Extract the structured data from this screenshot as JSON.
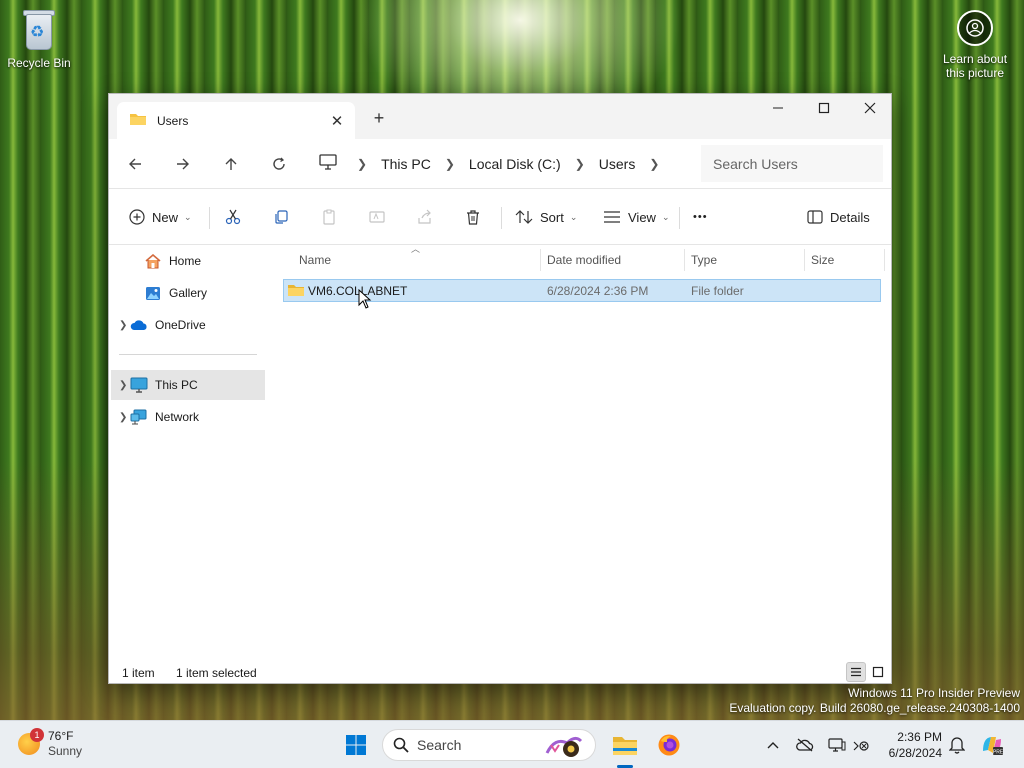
{
  "desktop": {
    "recycle_bin_label": "Recycle Bin",
    "learn_line1": "Learn about",
    "learn_line2": "this picture",
    "watermark_line1": "Windows 11 Pro Insider Preview",
    "watermark_line2": "Evaluation copy. Build 26080.ge_release.240308-1400"
  },
  "window": {
    "tab_title": "Users",
    "tab_close": "✕",
    "new_tab": "+",
    "breadcrumb": [
      "This PC",
      "Local Disk (C:)",
      "Users"
    ],
    "search_placeholder": "Search Users",
    "toolbar": {
      "new_label": "New",
      "sort_label": "Sort",
      "view_label": "View",
      "more_label": "•••",
      "details_label": "Details"
    },
    "nav": {
      "home": "Home",
      "gallery": "Gallery",
      "onedrive": "OneDrive",
      "this_pc": "This PC",
      "network": "Network"
    },
    "columns": {
      "name": "Name",
      "date": "Date modified",
      "type": "Type",
      "size": "Size"
    },
    "files": [
      {
        "name": "VM6.COLLABNET",
        "date": "6/28/2024 2:36 PM",
        "type": "File folder",
        "size": ""
      }
    ],
    "status": {
      "count": "1 item",
      "selected": "1 item selected"
    }
  },
  "taskbar": {
    "weather_badge": "1",
    "temperature": "76°F",
    "condition": "Sunny",
    "search_label": "Search",
    "time": "2:36 PM",
    "date": "6/28/2024",
    "accent": "#0067c0"
  }
}
